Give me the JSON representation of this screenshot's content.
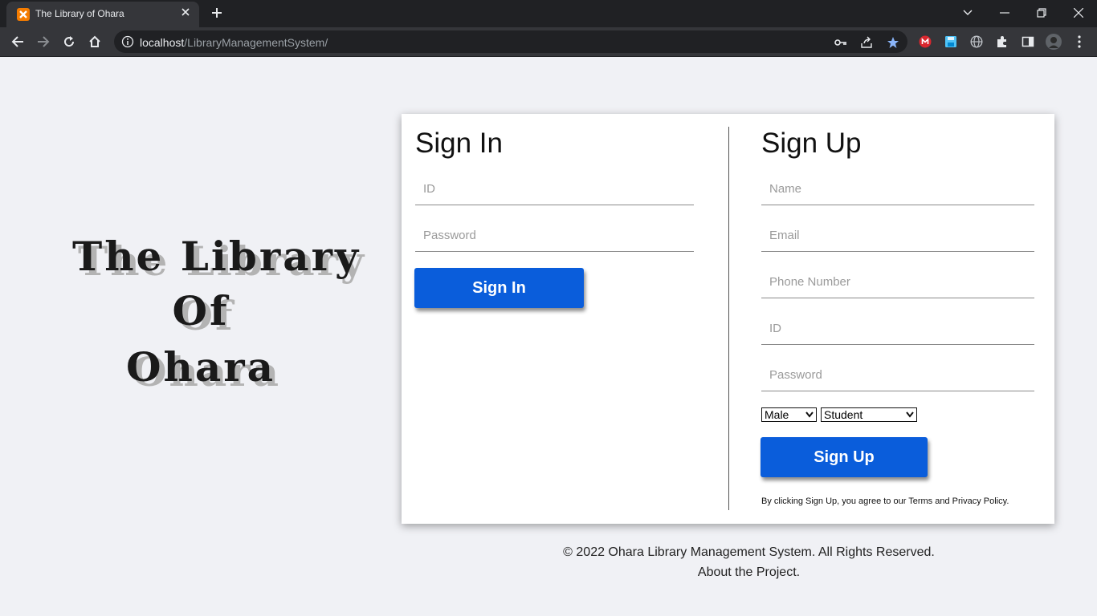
{
  "browser": {
    "tab_title": "The Library of Ohara",
    "url_host": "localhost",
    "url_path": "/LibraryManagementSystem/"
  },
  "logo": {
    "line1": "The Library",
    "line2": "Of",
    "line3": "Ohara"
  },
  "signin": {
    "title": "Sign In",
    "id_placeholder": "ID",
    "password_placeholder": "Password",
    "button_label": "Sign In"
  },
  "signup": {
    "title": "Sign Up",
    "name_placeholder": "Name",
    "email_placeholder": "Email",
    "phone_placeholder": "Phone Number",
    "id_placeholder": "ID",
    "password_placeholder": "Password",
    "gender_value": "Male",
    "role_value": "Student",
    "button_label": "Sign Up",
    "legal_prefix": "By clicking Sign Up, you agree to our ",
    "terms_link": "Terms",
    "legal_and": " and ",
    "privacy_link": "Privacy Policy",
    "legal_suffix": "."
  },
  "footer": {
    "copyright": "© 2022 Ohara Library Management System. All Rights Reserved.",
    "about_link": "About the Project."
  },
  "colors": {
    "accent": "#0a5ddb",
    "page_bg": "#f0f1f5"
  }
}
